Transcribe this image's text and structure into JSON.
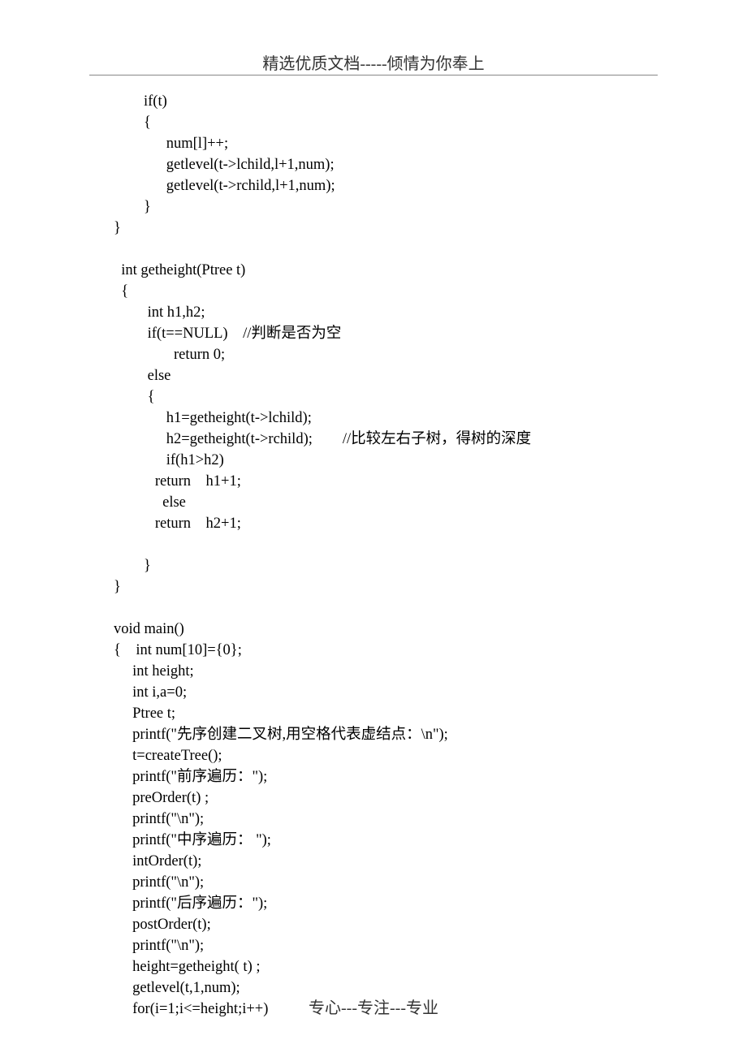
{
  "header": {
    "text": "精选优质文档-----倾情为你奉上"
  },
  "footer": {
    "text": "专心---专注---专业"
  },
  "code": {
    "lines": [
      "        if(t)",
      "        {",
      "              num[l]++;",
      "              getlevel(t->lchild,l+1,num);",
      "              getlevel(t->rchild,l+1,num);",
      "        }",
      "}",
      "",
      "  int getheight(Ptree t)",
      "  {",
      "         int h1,h2;",
      "         if(t==NULL)    //判断是否为空",
      "                return 0;",
      "         else",
      "         {",
      "              h1=getheight(t->lchild);",
      "              h2=getheight(t->rchild);        //比较左右子树，得树的深度",
      "              if(h1>h2)",
      "           return    h1+1;",
      "             else",
      "           return    h2+1;",
      "",
      "        }",
      "}",
      "",
      "void main()",
      "{    int num[10]={0};",
      "     int height;",
      "     int i,a=0;",
      "     Ptree t;",
      "     printf(\"先序创建二叉树,用空格代表虚结点：\\n\");",
      "     t=createTree();",
      "     printf(\"前序遍历：\");",
      "     preOrder(t) ;",
      "     printf(\"\\n\");",
      "     printf(\"中序遍历： \");",
      "     intOrder(t);",
      "     printf(\"\\n\");",
      "     printf(\"后序遍历：\");",
      "     postOrder(t);",
      "     printf(\"\\n\");",
      "     height=getheight( t) ;",
      "     getlevel(t,1,num);",
      "     for(i=1;i<=height;i++)"
    ]
  }
}
